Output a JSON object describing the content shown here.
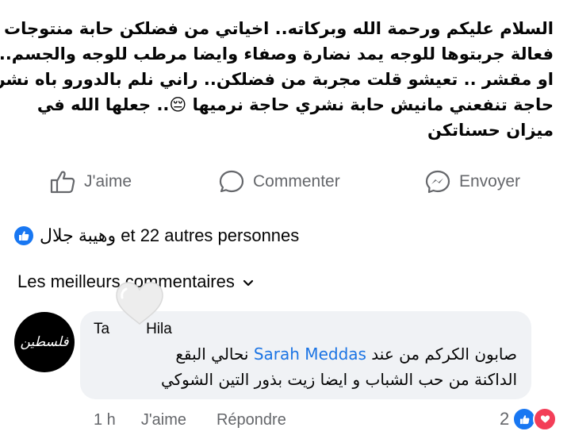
{
  "post": {
    "lines": [
      "السلام عليكم ورحمة الله وبركاته.. اخياتي من فضلكن  حابة منتوجات",
      "فعالة جربتوها للوجه يمد نضارة وصفاء وايضا مرطب للوجه والجسم..",
      "او مقشر .. تعيشو قلت مجربة من فضلكن.. راني نلم بالدورو باه نشري",
      "حاجة تنفعني  مانيش حابة نشري حاجة نرميها 😔.. جعلها الله في",
      "ميزان حسناتكن"
    ]
  },
  "actions": {
    "like_label": "J'aime",
    "comment_label": "Commenter",
    "share_label": "Envoyer"
  },
  "reactions": {
    "summary": "وهيبة جلال et 22 autres personnes"
  },
  "comments": {
    "sort_label": "Les meilleurs commentaires",
    "top_comment": {
      "author_start": "Ta",
      "author_end": "Hila",
      "avatar_text": "فلسطين",
      "body_prefix": "صابون الكركم من عند ",
      "mention": "Sarah Meddas",
      "body_suffix": " نحالي  البقع",
      "body_line2": "الداكنة من حب الشباب و ايضا زيت بذور التين الشوكي",
      "time": "1 h",
      "like_label": "J'aime",
      "reply_label": "Répondre",
      "reaction_count": "2"
    }
  },
  "colors": {
    "accent": "#1877f2",
    "muted": "#65676b",
    "bubble": "#f0f2f5",
    "love": "#f33e58"
  }
}
